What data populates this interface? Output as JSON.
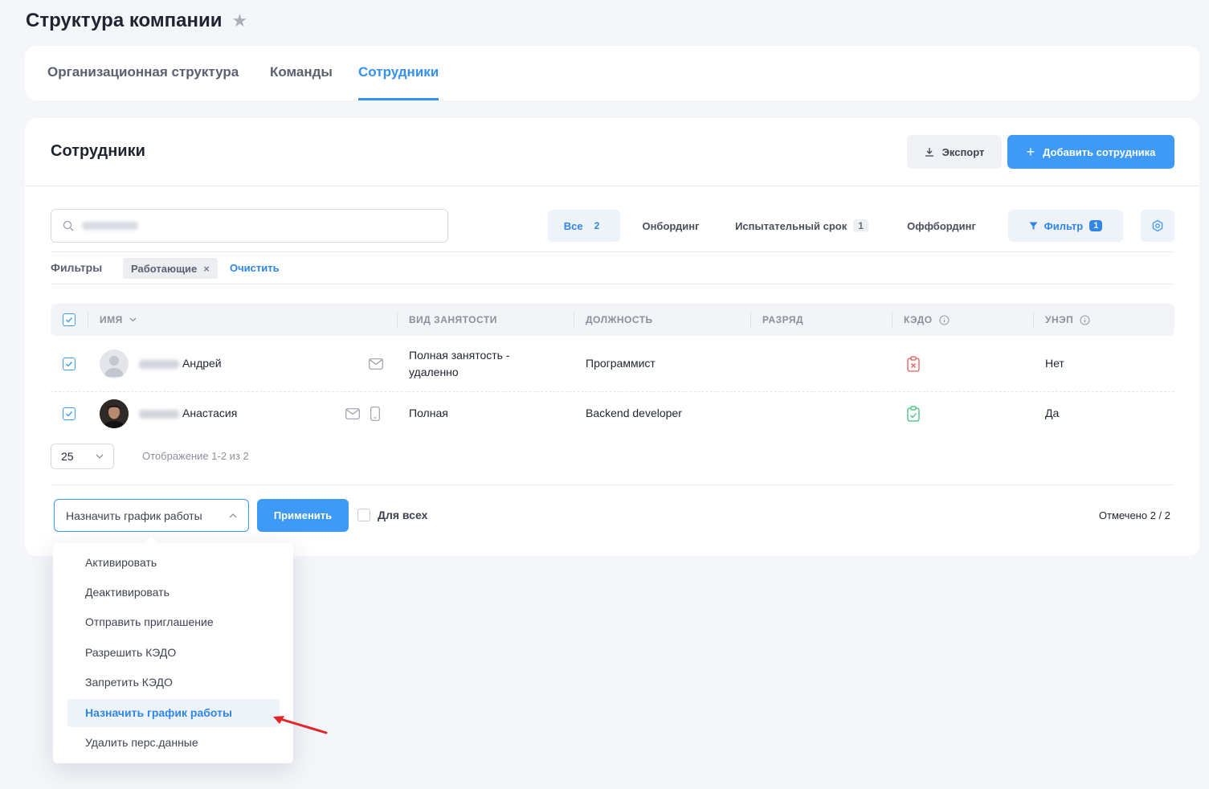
{
  "page": {
    "title": "Структура компании"
  },
  "tabs": [
    {
      "label": "Организационная структура"
    },
    {
      "label": "Команды"
    },
    {
      "label": "Сотрудники",
      "active": true
    }
  ],
  "section": {
    "title": "Сотрудники",
    "export_label": "Экспорт",
    "add_label": "Добавить сотрудника"
  },
  "segments": [
    {
      "label": "Все",
      "count": "2",
      "active": true
    },
    {
      "label": "Онбординг",
      "count": ""
    },
    {
      "label": "Испытательный срок",
      "count": "1"
    },
    {
      "label": "Оффбординг",
      "count": ""
    }
  ],
  "filter": {
    "label": "Фильтр",
    "count": "1"
  },
  "filters_bar": {
    "label": "Фильтры",
    "chip": "Работающие",
    "clear": "Очистить"
  },
  "table": {
    "columns": [
      "ИМЯ",
      "ВИД ЗАНЯТОСТИ",
      "ДОЛЖНОСТЬ",
      "РАЗРЯД",
      "КЭДО",
      "УНЭП"
    ],
    "rows": [
      {
        "name": "Андрей",
        "employment": "Полная занятость - удаленно",
        "position": "Программист",
        "grade": "",
        "kedo": "denied",
        "unep": "Нет"
      },
      {
        "name": "Анастасия",
        "employment": "Полная",
        "position": "Backend developer",
        "grade": "",
        "kedo": "allowed",
        "unep": "Да"
      }
    ]
  },
  "pagination": {
    "page_size": "25",
    "display_info": "Отображение 1-2 из 2"
  },
  "bulk_actions": {
    "selected_action": "Назначить график работы",
    "apply_label": "Применить",
    "for_all_label": "Для всех",
    "selected_count": "Отмечено 2 / 2"
  },
  "dropdown": {
    "items": [
      {
        "label": "Активировать"
      },
      {
        "label": "Деактивировать"
      },
      {
        "label": "Отправить приглашение"
      },
      {
        "label": "Разрешить КЭДО"
      },
      {
        "label": "Запретить КЭДО"
      },
      {
        "label": "Назначить график работы",
        "active": true
      },
      {
        "label": "Удалить перс.данные"
      }
    ]
  },
  "colors": {
    "accent": "#3f9af5",
    "kedo_denied": "#e45a5a",
    "kedo_allowed": "#3ebd7a",
    "annotation_arrow": "#e0262a"
  }
}
